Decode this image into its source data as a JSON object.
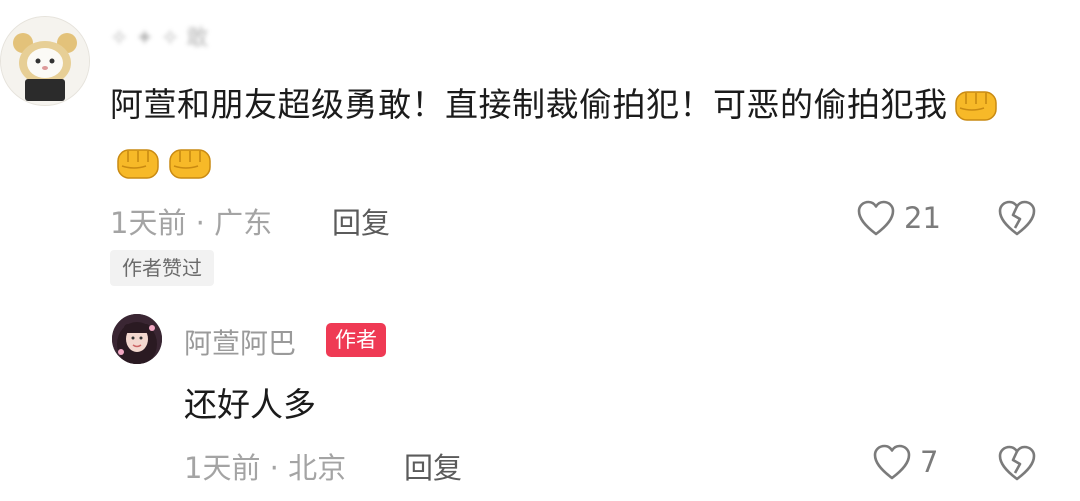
{
  "comment": {
    "username": "✧ ✦ ✧ 敢",
    "text": "阿萱和朋友超级勇敢！直接制裁偷拍犯！可恶的偷拍犯我",
    "emoji_count": 3,
    "emoji_name": "fist-emoji",
    "time": "1天前",
    "separator": " · ",
    "location": "广东",
    "reply_label": "回复",
    "like_count": "21",
    "author_liked_label": "作者赞过"
  },
  "reply": {
    "username": "阿萱阿巴",
    "author_badge": "作者",
    "text": "还好人多",
    "time": "1天前",
    "separator": " · ",
    "location": "北京",
    "reply_label": "回复",
    "like_count": "7"
  },
  "colors": {
    "author_badge": "#ef3a54",
    "meta_text": "#a4a4a4",
    "main_text": "#1b1b1b"
  }
}
